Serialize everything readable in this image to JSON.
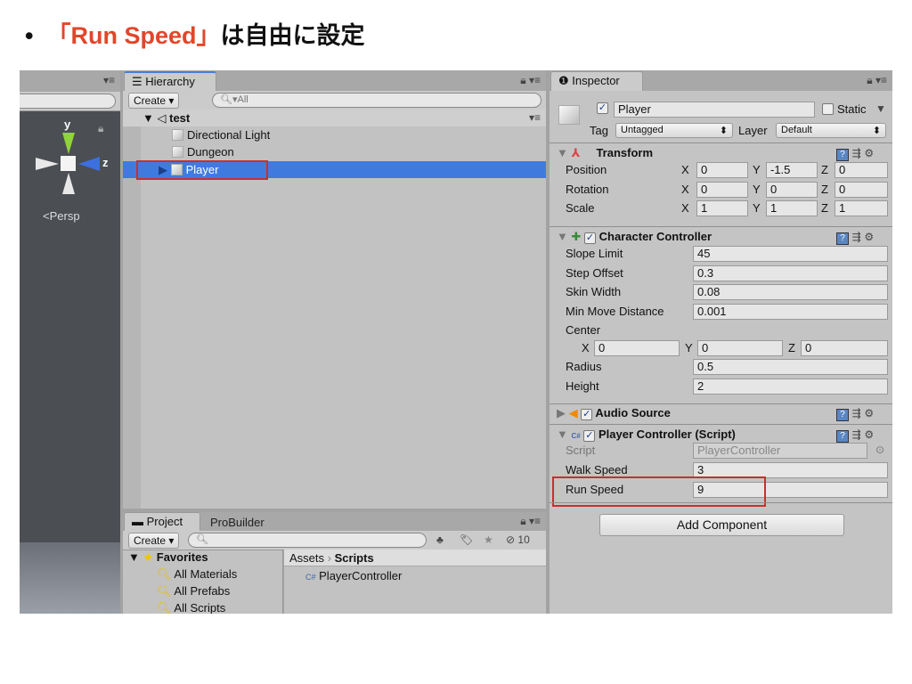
{
  "slide": {
    "bullet": "•",
    "title_highlight": "「Run Speed」",
    "title_rest": "は自由に設定"
  },
  "colors": {
    "accent_red": "#e2462a",
    "selection": "#3f7bde",
    "annotation_box": "#c8302a"
  },
  "scene": {
    "axis_y": "y",
    "axis_z": "z",
    "persp": "<Persp"
  },
  "hierarchy": {
    "tab": "Hierarchy",
    "create": "Create ▾",
    "search_placeholder": "All",
    "scene": "test",
    "items": [
      {
        "label": "Directional Light"
      },
      {
        "label": "Dungeon"
      },
      {
        "label": "Player",
        "selected": true
      }
    ]
  },
  "project": {
    "tabs": [
      "Project",
      "ProBuilder"
    ],
    "create": "Create ▾",
    "hidden_count": "10",
    "favorites": "Favorites",
    "fav_items": [
      "All Materials",
      "All Prefabs",
      "All Scripts"
    ],
    "breadcrumb": [
      "Assets",
      "Scripts"
    ],
    "files": [
      "PlayerController"
    ]
  },
  "inspector": {
    "tab": "Inspector",
    "name": "Player",
    "static": "Static",
    "tag_label": "Tag",
    "tag": "Untagged",
    "layer_label": "Layer",
    "layer": "Default",
    "transform": {
      "title": "Transform",
      "rows": [
        {
          "label": "Position",
          "x": "0",
          "y": "-1.5",
          "z": "0"
        },
        {
          "label": "Rotation",
          "x": "0",
          "y": "0",
          "z": "0"
        },
        {
          "label": "Scale",
          "x": "1",
          "y": "1",
          "z": "1"
        }
      ]
    },
    "character_controller": {
      "title": "Character Controller",
      "rows": [
        {
          "label": "Slope Limit",
          "value": "45"
        },
        {
          "label": "Step Offset",
          "value": "0.3"
        },
        {
          "label": "Skin Width",
          "value": "0.08"
        },
        {
          "label": "Min Move Distance",
          "value": "0.001"
        }
      ],
      "center_label": "Center",
      "center": {
        "x": "0",
        "y": "0",
        "z": "0"
      },
      "rows2": [
        {
          "label": "Radius",
          "value": "0.5"
        },
        {
          "label": "Height",
          "value": "2"
        }
      ]
    },
    "audio_source": {
      "title": "Audio Source"
    },
    "player_controller": {
      "title": "Player Controller (Script)",
      "script_label": "Script",
      "script": "PlayerController",
      "rows": [
        {
          "label": "Walk Speed",
          "value": "3"
        },
        {
          "label": "Run Speed",
          "value": "9"
        }
      ]
    },
    "add_component": "Add Component"
  },
  "axis_letters": {
    "x": "X",
    "y": "Y",
    "z": "Z"
  }
}
